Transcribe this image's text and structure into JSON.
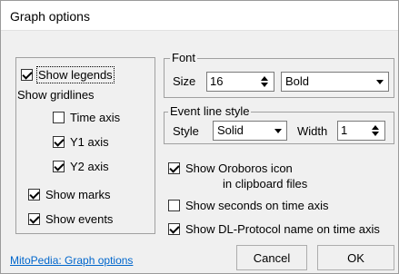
{
  "window": {
    "title": "Graph options"
  },
  "left": {
    "show_legends": {
      "label": "Show legends",
      "checked": true
    },
    "show_gridlines_label": "Show gridlines",
    "time_axis": {
      "label": "Time axis",
      "checked": false
    },
    "y1_axis": {
      "label": "Y1 axis",
      "checked": true
    },
    "y2_axis": {
      "label": "Y2 axis",
      "checked": true
    },
    "show_marks": {
      "label": "Show marks",
      "checked": true
    },
    "show_events": {
      "label": "Show events",
      "checked": true
    }
  },
  "font": {
    "group_label": "Font",
    "size_label": "Size",
    "size_value": "16",
    "weight_value": "Bold"
  },
  "event_line_style": {
    "group_label": "Event line style",
    "style_label": "Style",
    "style_value": "Solid",
    "width_label": "Width",
    "width_value": "1"
  },
  "options": {
    "oroboros_icon": {
      "label": "Show Oroboros icon",
      "label_line2": "in clipboard files",
      "checked": true
    },
    "show_seconds": {
      "label": "Show seconds on time axis",
      "checked": false
    },
    "show_dl_protocol": {
      "label": "Show DL-Protocol name on time axis",
      "checked": true
    }
  },
  "footer": {
    "link": "MitoPedia: Graph options",
    "cancel": "Cancel",
    "ok": "OK"
  }
}
